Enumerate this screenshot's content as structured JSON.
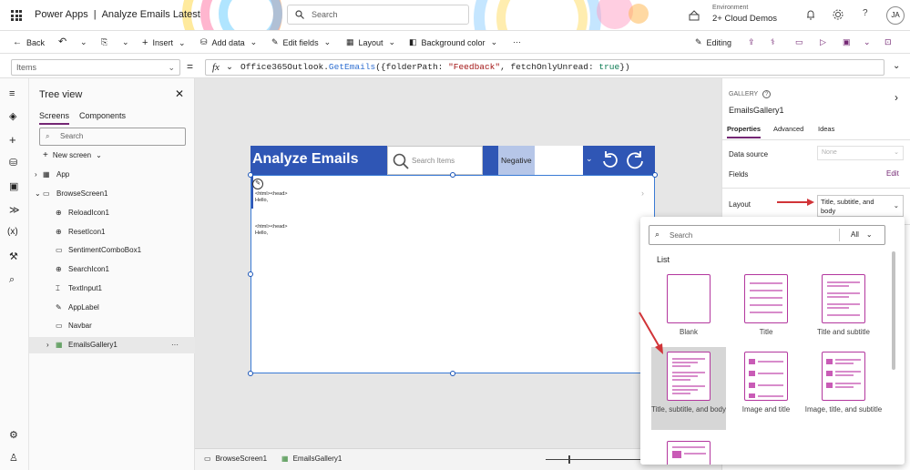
{
  "header": {
    "app_name": "Power Apps",
    "separator": "|",
    "doc_title": "Analyze Emails Latest",
    "search_placeholder": "Search",
    "env_label": "Environment",
    "env_name": "2+ Cloud Demos",
    "avatar": "JA"
  },
  "toolbar": {
    "back": "Back",
    "insert": "Insert",
    "add_data": "Add data",
    "edit_fields": "Edit fields",
    "layout": "Layout",
    "background_color": "Background color",
    "more": "···",
    "editing": "Editing"
  },
  "formula": {
    "property": "Items",
    "equals": "=",
    "fx": "fx",
    "fn_obj": "Office365Outlook.",
    "fn_name": "GetEmails",
    "args_open": "({folderPath: ",
    "arg_value": "\"Feedback\"",
    "args_mid": ", fetchOnlyUnread: ",
    "arg_bool": "true",
    "args_close": "})"
  },
  "tree": {
    "title": "Tree view",
    "tab_screens": "Screens",
    "tab_components": "Components",
    "search_placeholder": "Search",
    "new_screen": "New screen",
    "items": [
      "App",
      "BrowseScreen1",
      "ReloadIcon1",
      "ResetIcon1",
      "SentimentComboBox1",
      "SearchIcon1",
      "TextInput1",
      "AppLabel",
      "Navbar",
      "EmailsGallery1"
    ]
  },
  "app_canvas": {
    "title": "Analyze Emails",
    "search_placeholder": "Search Items",
    "combo_value": "Negative",
    "row1_line1": "<html><head>",
    "row1_line2": "Hello,",
    "row2_line1": "<html><head>",
    "row2_line2": "Hello,"
  },
  "screenbar": {
    "screen": "BrowseScreen1",
    "control": "EmailsGallery1"
  },
  "props": {
    "type_label": "GALLERY",
    "control_name": "EmailsGallery1",
    "tab_properties": "Properties",
    "tab_advanced": "Advanced",
    "tab_ideas": "Ideas",
    "data_source_label": "Data source",
    "data_source_value": "None",
    "fields_label": "Fields",
    "fields_edit": "Edit",
    "layout_label": "Layout",
    "layout_value": "Title, subtitle, and body"
  },
  "layout_popup": {
    "search_placeholder": "Search",
    "filter": "All",
    "section": "List",
    "options": [
      "Blank",
      "Title",
      "Title and subtitle",
      "Title, subtitle, and body",
      "Image and title",
      "Image, title, and subtitle"
    ]
  },
  "colors": {
    "nav_blue": "#2f56b5",
    "accent_purple": "#742774",
    "arrow_red": "#d13438",
    "selected_option_bg": "#d6d6d6"
  }
}
